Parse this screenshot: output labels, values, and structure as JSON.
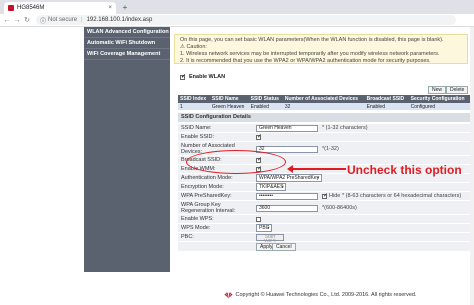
{
  "browser": {
    "tab_title": "HG8546M",
    "tab_close": "×",
    "new_tab": "+",
    "security_label": "Not secure",
    "url": "192.168.100.1/index.asp"
  },
  "sidebar": {
    "items": [
      {
        "label": "WLAN Advanced Configuration"
      },
      {
        "label": "Automatic WiFi Shutdown"
      },
      {
        "label": "WiFi Coverage Management"
      }
    ]
  },
  "info": {
    "lines": [
      "On this page, you can set basic WLAN parameters(When the WLAN function is disabled, this page is blank).",
      "⚠ Caution:",
      "1. Wireless network services may be interrupted temporarily after you modify wireless network parameters.",
      "2. It is recommended that you use the WPA2 or WPA/WPA2 authentication mode for security purposes."
    ]
  },
  "enable_wlan": {
    "label": "Enable WLAN",
    "checked": true
  },
  "buttons": {
    "new": "New",
    "delete": "Delete"
  },
  "ssid_table": {
    "headers": [
      "SSID Index",
      "SSID Name",
      "SSID Status",
      "Number of Associated Devices",
      "Broadcast SSID",
      "Security Configuration"
    ],
    "rows": [
      [
        "1",
        "Green Heaven",
        "Enabled",
        "32",
        "Enabled",
        "Configured"
      ]
    ]
  },
  "section_title": "SSID Configuration Details",
  "form": {
    "ssid_name": {
      "label": "SSID Name:",
      "value": "Green Heaven",
      "hint": "* (1-32 characters)"
    },
    "enable_ssid": {
      "label": "Enable SSID:",
      "checked": true
    },
    "assoc_devices": {
      "label": "Number of Associated Devices:",
      "value": "32",
      "hint": "*(1-32)"
    },
    "broadcast_ssid": {
      "label": "Broadcast SSID:",
      "checked": true
    },
    "enable_wmm": {
      "label": "Enable WMM:",
      "checked": true
    },
    "auth_mode": {
      "label": "Authentication Mode:",
      "value": "WPA/WPA2 PreSharedKey"
    },
    "encryption_mode": {
      "label": "Encryption Mode:",
      "value": "TKIP&AES"
    },
    "psk": {
      "label": "WPA PreSharedKey:",
      "value": "••••••••",
      "hide_label": "Hide",
      "hint": "* (8-63 characters or 64 hexadecimal characters)"
    },
    "rekey": {
      "label": "WPA Group Key Regeneration Interval:",
      "value": "3600",
      "hint": "*(600-86400s)"
    },
    "enable_wps": {
      "label": "Enable WPS:",
      "checked": false
    },
    "wps_mode": {
      "label": "WPS Mode:",
      "value": "PBC"
    },
    "pbc": {
      "label": "PBC:",
      "button": "Start WPS"
    }
  },
  "actions": {
    "apply": "Apply",
    "cancel": "Cancel"
  },
  "annotation": {
    "text": "Uncheck this option",
    "color": "#e11b22"
  },
  "footer": {
    "copyright": "Copyright © Huawei Technologies Co., Ltd. 2009-2016. All rights reserved."
  },
  "colors": {
    "sidebar": "#5a6270",
    "info_bg": "#fcf7dd",
    "annotation": "#e11b22"
  }
}
